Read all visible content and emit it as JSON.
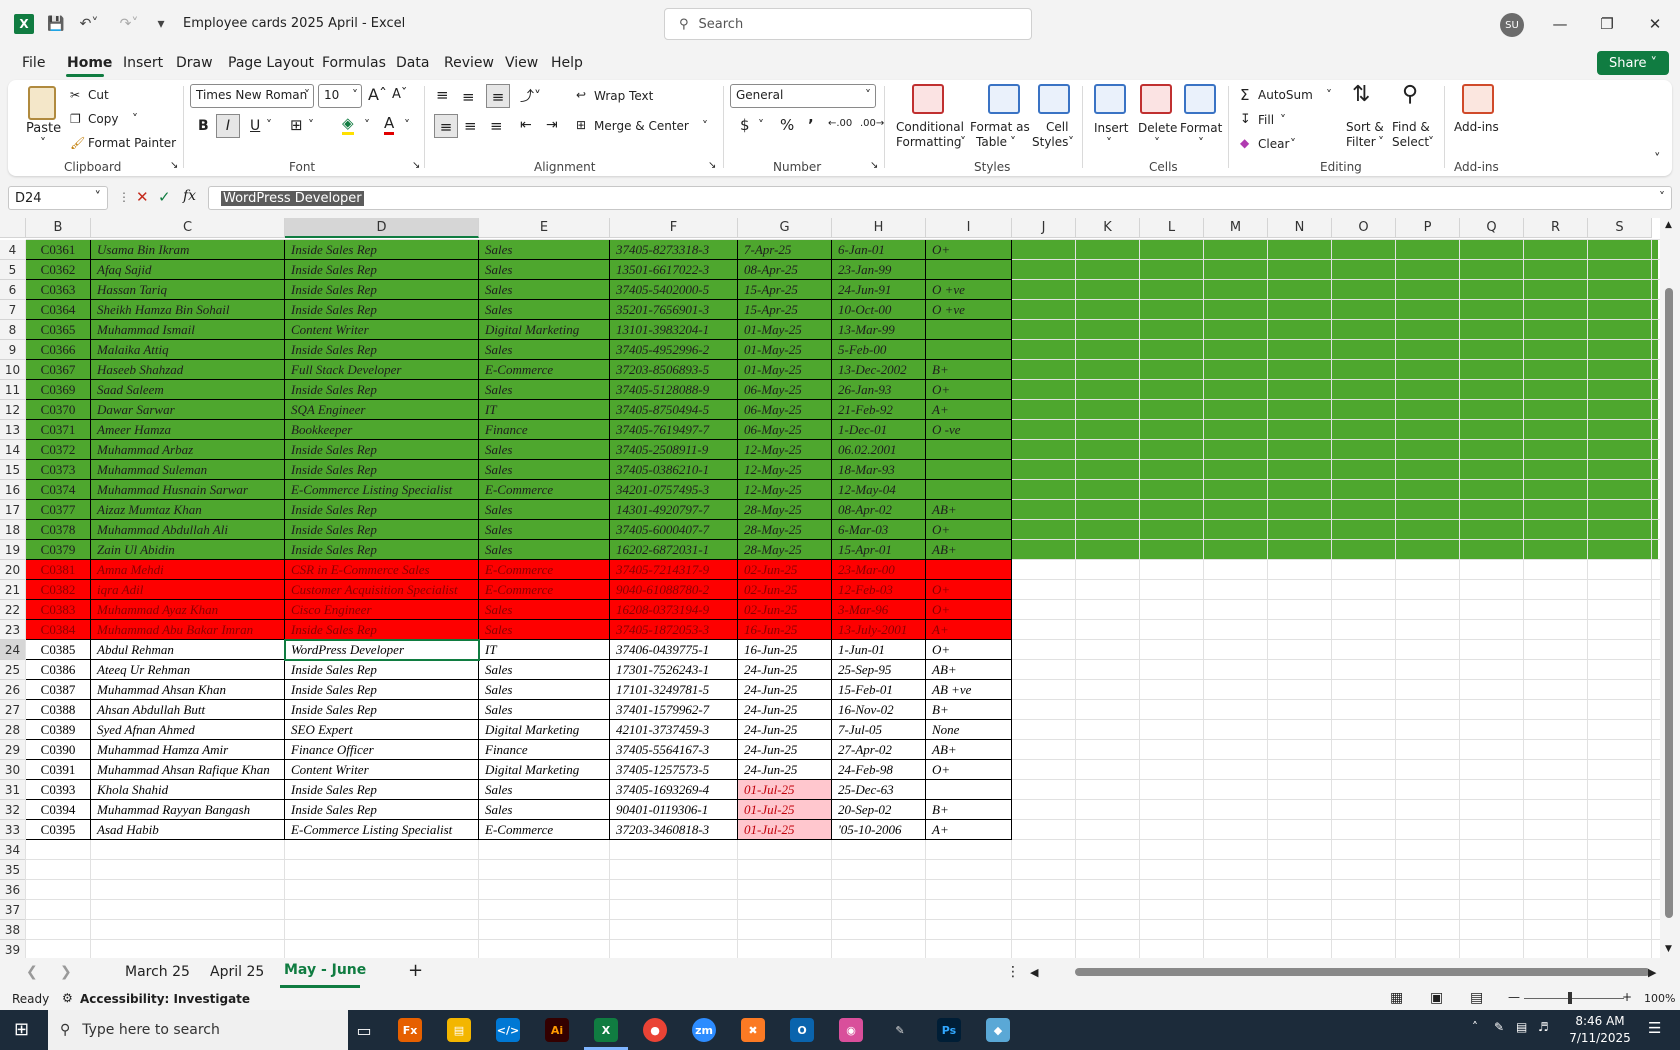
{
  "titlebar": {
    "doc_title": "Employee cards 2025 April  -  Excel",
    "search_placeholder": "Search",
    "avatar": "SU"
  },
  "menu": [
    "File",
    "Home",
    "Insert",
    "Draw",
    "Page Layout",
    "Formulas",
    "Data",
    "Review",
    "View",
    "Help"
  ],
  "share_label": "Share",
  "ribbon": {
    "paste": "Paste",
    "cut": "Cut",
    "copy": "Copy",
    "format_painter": "Format Painter",
    "clipboard": "Clipboard",
    "font_name": "Times New Roman",
    "font_size": "10",
    "font": "Font",
    "wrap_text": "Wrap Text",
    "merge_center": "Merge & Center",
    "alignment": "Alignment",
    "number_format": "General",
    "number": "Number",
    "conditional": "Conditional",
    "formatting": "Formatting",
    "format_as": "Format as",
    "table": "Table",
    "cell": "Cell",
    "styles_lbl": "Styles",
    "styles": "Styles",
    "insert": "Insert",
    "delete": "Delete",
    "format": "Format",
    "cells": "Cells",
    "autosum": "AutoSum",
    "fill": "Fill",
    "clear": "Clear",
    "sort_filter1": "Sort &",
    "sort_filter2": "Filter",
    "find1": "Find &",
    "find2": "Select",
    "editing": "Editing",
    "addins": "Add-ins",
    "addins_grp": "Add-ins"
  },
  "formula_bar": {
    "name_box": "D24",
    "fx": "fx",
    "content": "WordPress Developer"
  },
  "columns": [
    "B",
    "C",
    "D",
    "E",
    "F",
    "G",
    "H",
    "I",
    "J",
    "K",
    "L",
    "M",
    "N",
    "O",
    "P",
    "Q",
    "R",
    "S"
  ],
  "rows": [
    {
      "n": "4",
      "style": "green",
      "cells": [
        "C0361",
        "Usama Bin Ikram",
        "Inside Sales Rep",
        "Sales",
        "37405-8273318-3",
        "7-Apr-25",
        "6-Jan-01",
        "O+"
      ]
    },
    {
      "n": "5",
      "style": "green",
      "cells": [
        "C0362",
        "Afaq Sajid",
        "Inside Sales Rep",
        "Sales",
        "13501-6617022-3",
        "08-Apr-25",
        "23-Jan-99",
        ""
      ]
    },
    {
      "n": "6",
      "style": "green",
      "cells": [
        "C0363",
        "Hassan Tariq",
        "Inside Sales Rep",
        "Sales",
        "37405-5402000-5",
        "15-Apr-25",
        "24-Jun-91",
        "O +ve"
      ]
    },
    {
      "n": "7",
      "style": "green",
      "cells": [
        "C0364",
        "Sheikh Hamza Bin Sohail",
        "Inside Sales Rep",
        "Sales",
        "35201-7656901-3",
        "15-Apr-25",
        "10-Oct-00",
        "O +ve"
      ]
    },
    {
      "n": "8",
      "style": "green",
      "cells": [
        "C0365",
        "Muhammad Ismail",
        "Content Writer",
        "Digital Marketing",
        "13101-3983204-1",
        "01-May-25",
        "13-Mar-99",
        ""
      ]
    },
    {
      "n": "9",
      "style": "green",
      "cells": [
        "C0366",
        "Malaika Attiq",
        "Inside Sales Rep",
        "Sales",
        "37405-4952996-2",
        "01-May-25",
        "5-Feb-00",
        ""
      ]
    },
    {
      "n": "10",
      "style": "green",
      "cells": [
        "C0367",
        "Haseeb Shahzad",
        "Full Stack Developer",
        "E-Commerce",
        "37203-8506893-5",
        "01-May-25",
        "13-Dec-2002",
        "B+"
      ]
    },
    {
      "n": "11",
      "style": "green",
      "cells": [
        "C0369",
        "Saad Saleem",
        "Inside Sales Rep",
        "Sales",
        "37405-5128088-9",
        "06-May-25",
        "26-Jan-93",
        "O+"
      ]
    },
    {
      "n": "12",
      "style": "green",
      "cells": [
        "C0370",
        "Dawar Sarwar",
        "SQA Engineer",
        "IT",
        "37405-8750494-5",
        "06-May-25",
        "21-Feb-92",
        "A+"
      ]
    },
    {
      "n": "13",
      "style": "green",
      "cells": [
        "C0371",
        "Ameer Hamza",
        "Bookkeeper",
        "Finance",
        "37405-7619497-7",
        "06-May-25",
        "1-Dec-01",
        "O -ve"
      ]
    },
    {
      "n": "14",
      "style": "green",
      "cells": [
        "C0372",
        "Muhammad Arbaz",
        "Inside Sales Rep",
        "Sales",
        "37405-2508911-9",
        "12-May-25",
        "06.02.2001",
        ""
      ]
    },
    {
      "n": "15",
      "style": "green",
      "cells": [
        "C0373",
        "Muhammad Suleman",
        "Inside Sales Rep",
        "Sales",
        "37405-0386210-1",
        "12-May-25",
        "18-Mar-93",
        ""
      ]
    },
    {
      "n": "16",
      "style": "green",
      "cells": [
        "C0374",
        "Muhammad Husnain Sarwar",
        "E-Commerce Listing Specialist",
        "E-Commerce",
        "34201-0757495-3",
        "12-May-25",
        "12-May-04",
        ""
      ]
    },
    {
      "n": "17",
      "style": "green",
      "cells": [
        "C0377",
        "Aizaz Mumtaz Khan",
        "Inside Sales Rep",
        "Sales",
        "14301-4920797-7",
        "28-May-25",
        "08-Apr-02",
        "AB+"
      ]
    },
    {
      "n": "18",
      "style": "green",
      "cells": [
        "C0378",
        "Muhammad Abdullah Ali",
        "Inside Sales Rep",
        "Sales",
        "37405-6000407-7",
        "28-May-25",
        "6-Mar-03",
        "O+"
      ]
    },
    {
      "n": "19",
      "style": "green",
      "cells": [
        "C0379",
        "Zain Ul Abidin",
        "Inside Sales Rep",
        "Sales",
        "16202-6872031-1",
        "28-May-25",
        "15-Apr-01",
        "AB+"
      ]
    },
    {
      "n": "20",
      "style": "red",
      "cells": [
        "C0381",
        "Amna Mehdi",
        "CSR in E-Commerce Sales",
        "E-Commerce",
        "37405-7214317-9",
        "02-Jun-25",
        "23-Mar-00",
        ""
      ]
    },
    {
      "n": "21",
      "style": "red",
      "cells": [
        "C0382",
        "iqra Adil",
        "Customer Acquisition Specialist",
        "E-Commerce",
        "9040-61088780-2",
        "02-Jun-25",
        "12-Feb-03",
        "O+"
      ]
    },
    {
      "n": "22",
      "style": "red",
      "cells": [
        "C0383",
        "Muhammad Ayaz Khan",
        "Cisco Engineer",
        "Sales",
        "16208-0373194-9",
        "02-Jun-25",
        "3-Mar-96",
        "O+"
      ]
    },
    {
      "n": "23",
      "style": "red",
      "cells": [
        "C0384",
        "Muhammad Abu Bakar Imran",
        "Inside Sales Rep",
        "Sales",
        "37405-1872053-3",
        "16-Jun-25",
        "13-July-2001",
        "A+"
      ]
    },
    {
      "n": "24",
      "style": "white",
      "cells": [
        "C0385",
        "Abdul Rehman",
        "WordPress Developer",
        "IT",
        "37406-0439775-1",
        "16-Jun-25",
        "1-Jun-01",
        "O+"
      ]
    },
    {
      "n": "25",
      "style": "white",
      "cells": [
        "C0386",
        "Ateeq Ur Rehman",
        "Inside Sales Rep",
        "Sales",
        "17301-7526243-1",
        "24-Jun-25",
        "25-Sep-95",
        "AB+"
      ]
    },
    {
      "n": "26",
      "style": "white",
      "cells": [
        "C0387",
        "Muhammad Ahsan Khan",
        "Inside Sales Rep",
        "Sales",
        "17101-3249781-5",
        "24-Jun-25",
        "15-Feb-01",
        "AB +ve"
      ]
    },
    {
      "n": "27",
      "style": "white",
      "cells": [
        "C0388",
        "Ahsan Abdullah Butt",
        "Inside Sales Rep",
        "Sales",
        "37401-1579962-7",
        "24-Jun-25",
        "16-Nov-02",
        "B+"
      ]
    },
    {
      "n": "28",
      "style": "white",
      "cells": [
        "C0389",
        "Syed Afnan Ahmed",
        "SEO Expert",
        "Digital Marketing",
        "42101-3737459-3",
        "24-Jun-25",
        "7-Jul-05",
        "None"
      ]
    },
    {
      "n": "29",
      "style": "white",
      "cells": [
        "C0390",
        "Muhammad Hamza Amir",
        "Finance Officer",
        "Finance",
        "37405-5564167-3",
        "24-Jun-25",
        "27-Apr-02",
        "AB+"
      ]
    },
    {
      "n": "30",
      "style": "white",
      "cells": [
        "C0391",
        "Muhammad Ahsan Rafique Khan",
        "Content Writer",
        "Digital Marketing",
        "37405-1257573-5",
        "24-Jun-25",
        "24-Feb-98",
        "O+"
      ]
    },
    {
      "n": "31",
      "style": "white",
      "pink": true,
      "cells": [
        "C0393",
        "Khola Shahid",
        "Inside Sales Rep",
        "Sales",
        "37405-1693269-4",
        "01-Jul-25",
        "25-Dec-63",
        ""
      ]
    },
    {
      "n": "32",
      "style": "white",
      "pink": true,
      "cells": [
        "C0394",
        "Muhammad Rayyan Bangash",
        "Inside Sales Rep",
        "Sales",
        "90401-0119306-1",
        "01-Jul-25",
        "20-Sep-02",
        "B+"
      ]
    },
    {
      "n": "33",
      "style": "white",
      "pink": true,
      "cells": [
        "C0395",
        "Asad Habib",
        "E-Commerce Listing Specialist",
        "E-Commerce",
        "37203-3460818-3",
        "01-Jul-25",
        "'05-10-2006",
        "A+"
      ]
    }
  ],
  "empty_rows": [
    "34",
    "35",
    "36",
    "37",
    "38",
    "39"
  ],
  "sheets": [
    "March 25",
    "April 25",
    "May - June"
  ],
  "status": {
    "ready": "Ready",
    "accessibility": "Accessibility: Investigate",
    "zoom": "100%"
  },
  "taskbar": {
    "search": "Type here to search",
    "time": "8:46 AM",
    "date": "7/11/2025"
  },
  "colors": {
    "green_fill": "#4ea72e",
    "red_fill": "#fe0000",
    "pink_fill": "#ffc7ce",
    "accent": "#107c41"
  }
}
